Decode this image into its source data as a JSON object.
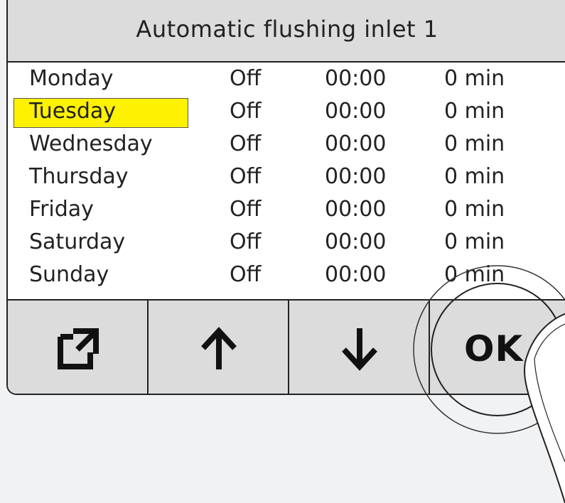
{
  "dialog": {
    "title": "Automatic flushing inlet 1"
  },
  "schedule": [
    {
      "day": "Monday",
      "state": "Off",
      "time": "00:00",
      "duration": "0 min",
      "selected": false
    },
    {
      "day": "Tuesday",
      "state": "Off",
      "time": "00:00",
      "duration": "0 min",
      "selected": true
    },
    {
      "day": "Wednesday",
      "state": "Off",
      "time": "00:00",
      "duration": "0 min",
      "selected": false
    },
    {
      "day": "Thursday",
      "state": "Off",
      "time": "00:00",
      "duration": "0 min",
      "selected": false
    },
    {
      "day": "Friday",
      "state": "Off",
      "time": "00:00",
      "duration": "0 min",
      "selected": false
    },
    {
      "day": "Saturday",
      "state": "Off",
      "time": "00:00",
      "duration": "0 min",
      "selected": false
    },
    {
      "day": "Sunday",
      "state": "Off",
      "time": "00:00",
      "duration": "0 min",
      "selected": false
    }
  ],
  "buttons": {
    "edit_icon": "open-edit-icon",
    "up_icon": "arrow-up-icon",
    "down_icon": "arrow-down-icon",
    "ok_label": "OK"
  },
  "colors": {
    "selection": "#fff200",
    "bar": "#dcdcdc",
    "background": "#f1f2f4"
  }
}
